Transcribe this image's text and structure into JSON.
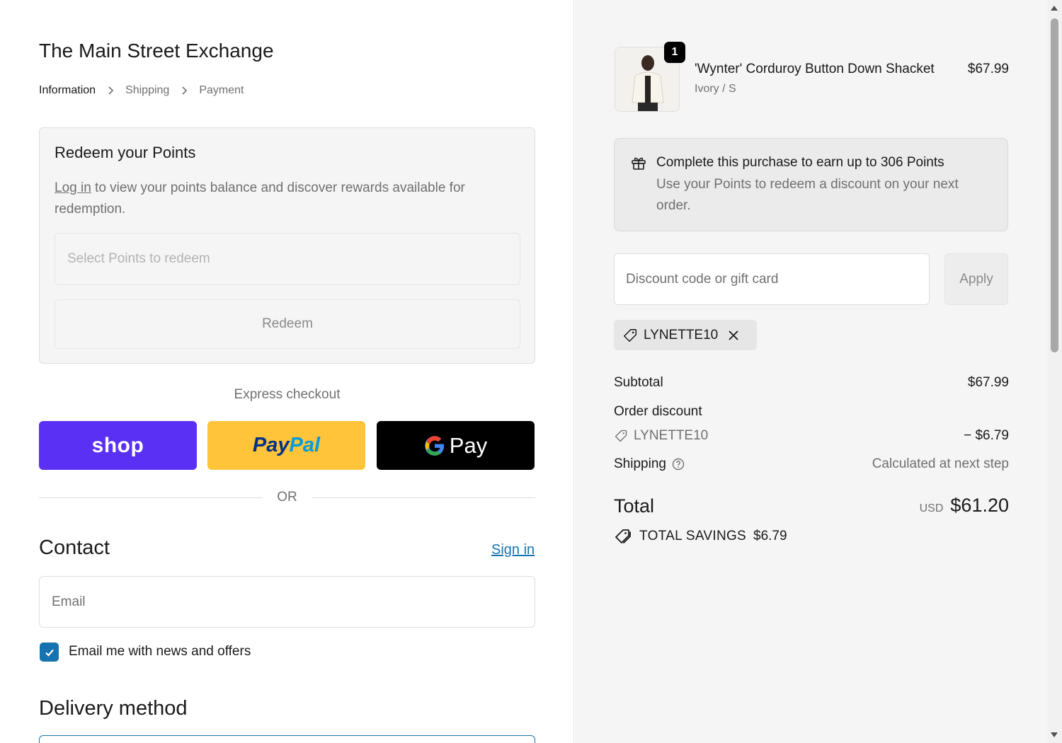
{
  "shop": {
    "title": "The Main Street Exchange"
  },
  "breadcrumb": {
    "items": [
      "Information",
      "Shipping",
      "Payment"
    ]
  },
  "points": {
    "title": "Redeem your Points",
    "login_link": "Log in",
    "description": " to view your points balance and discover rewards available for redemption.",
    "select_placeholder": "Select Points to redeem",
    "redeem_label": "Redeem"
  },
  "express": {
    "label": "Express checkout",
    "shop_label": "shop",
    "paypal_part1": "Pay",
    "paypal_part2": "Pal",
    "gpay_label": "Pay"
  },
  "divider": {
    "or_label": "OR"
  },
  "contact": {
    "title": "Contact",
    "signin_label": "Sign in",
    "email_placeholder": "Email",
    "newsletter_label": "Email me with news and offers",
    "newsletter_checked": true
  },
  "delivery": {
    "title": "Delivery method"
  },
  "cart": {
    "item": {
      "name": "'Wynter' Corduroy Button Down Shacket",
      "variant": "Ivory / S",
      "price": "$67.99",
      "quantity": "1"
    },
    "earn": {
      "title": "Complete this purchase to earn up to 306 Points",
      "description": "Use your Points to redeem a discount on your next order."
    },
    "discount": {
      "placeholder": "Discount code or gift card",
      "apply_label": "Apply",
      "applied_code": "LYNETTE10"
    },
    "summary": {
      "subtotal_label": "Subtotal",
      "subtotal_value": "$67.99",
      "order_discount_label": "Order discount",
      "discount_code": "LYNETTE10",
      "discount_value": "− $6.79",
      "shipping_label": "Shipping",
      "shipping_value": "Calculated at next step",
      "total_label": "Total",
      "total_currency": "USD",
      "total_value": "$61.20",
      "savings_label": "TOTAL SAVINGS",
      "savings_value": "$6.79"
    }
  },
  "colors": {
    "shop_pay": "#5a31f4",
    "paypal": "#ffc439",
    "link_blue": "#1773b0"
  },
  "icons": [
    "chevron-right-icon",
    "google-g-icon",
    "checkmark-icon",
    "gift-icon",
    "tag-icon",
    "close-icon",
    "help-circle-icon",
    "tags-icon"
  ]
}
